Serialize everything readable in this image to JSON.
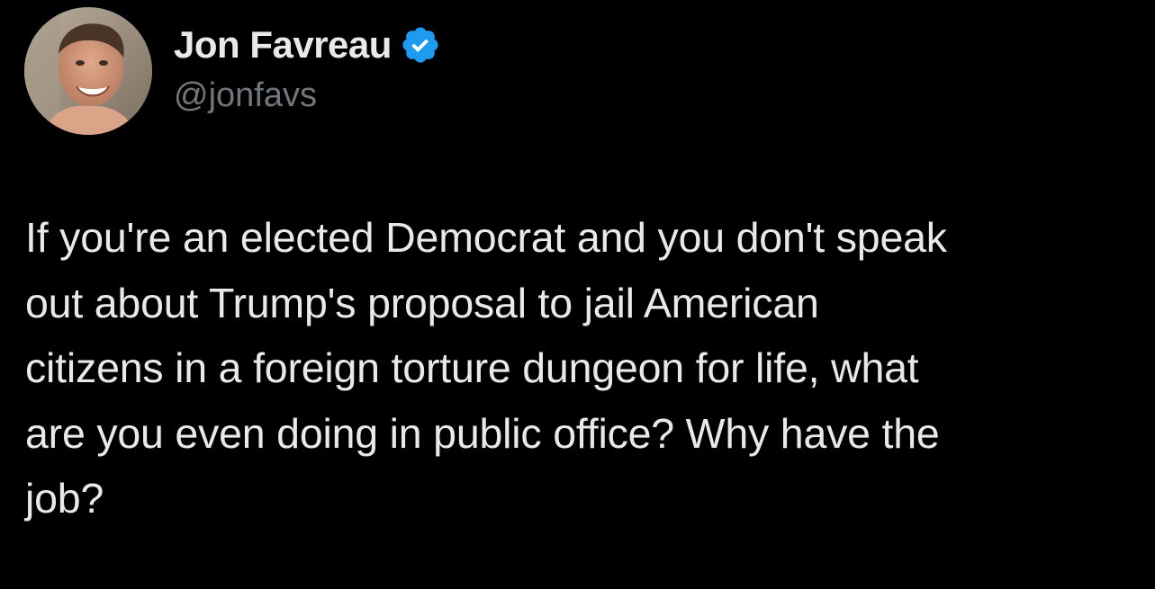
{
  "tweet": {
    "author": {
      "display_name": "Jon Favreau",
      "handle": "@jonfavs",
      "verified": true,
      "avatar_icon": "profile-photo"
    },
    "text": "If you're an elected Democrat and you don't speak\nout about Trump's proposal to jail American\ncitizens in a foreign torture dungeon for life, what\nare you even doing in public office? Why have the\njob?"
  },
  "colors": {
    "background": "#000000",
    "text_primary": "#e7e9ea",
    "text_secondary": "#71767b",
    "verified_badge": "#1d9bf0"
  }
}
